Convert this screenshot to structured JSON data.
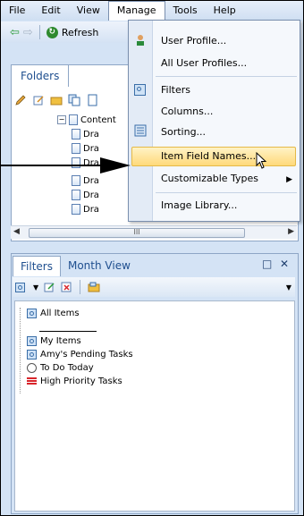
{
  "menubar": {
    "items": [
      "File",
      "Edit",
      "View",
      "Manage",
      "Tools",
      "Help"
    ]
  },
  "toolbar": {
    "refresh_label": "Refresh"
  },
  "folders_pane": {
    "tab_label": "Folders",
    "tree": {
      "root_label": "Content",
      "children": [
        "Dra",
        "Dra",
        "Dra",
        "Dra",
        "Dra",
        "Dra"
      ]
    },
    "scroll_thumb_label": "III"
  },
  "manage_menu": {
    "items": [
      {
        "label": "User Profile...",
        "icon": "user-icon"
      },
      {
        "label": "All User Profiles...",
        "icon": ""
      },
      {
        "label": "Filters",
        "icon": "filter-icon"
      },
      {
        "label": "Columns...",
        "icon": ""
      },
      {
        "label": "Sorting...",
        "icon": "sorting-icon"
      },
      {
        "label": "Item Field Names...",
        "icon": "",
        "highlighted": true
      },
      {
        "label": "Customizable Types",
        "icon": "",
        "submenu": true
      },
      {
        "label": "Image Library...",
        "icon": ""
      }
    ]
  },
  "lower_pane": {
    "tabs": [
      "Filters",
      "Month View"
    ],
    "active_tab": "Filters",
    "filters": [
      {
        "label": "All Items",
        "icon": "filter-icon"
      },
      {
        "label": "My Items",
        "icon": "filter-icon"
      },
      {
        "label": "Amy's Pending Tasks",
        "icon": "filter-icon"
      },
      {
        "label": "To Do Today",
        "icon": "clock-icon"
      },
      {
        "label": "High Priority Tasks",
        "icon": "priority-icon"
      }
    ]
  },
  "colors": {
    "frame_bg": "#d4e3f5",
    "menu_highlight": "#ffd97a",
    "tab_text": "#1f4f8f"
  }
}
